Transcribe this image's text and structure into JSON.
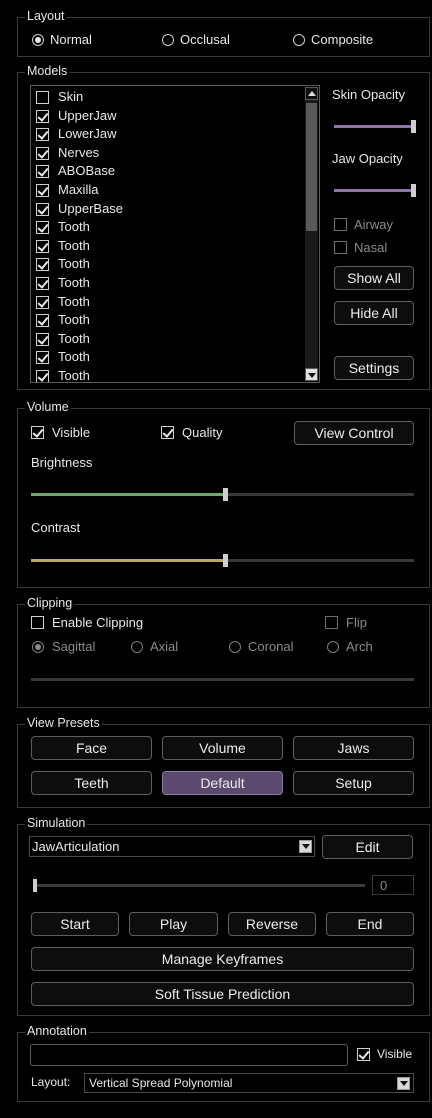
{
  "layout": {
    "title": "Layout",
    "options": [
      {
        "label": "Normal",
        "selected": true
      },
      {
        "label": "Occlusal",
        "selected": false
      },
      {
        "label": "Composite",
        "selected": false
      }
    ]
  },
  "models": {
    "title": "Models",
    "items": [
      {
        "label": "Skin",
        "checked": false
      },
      {
        "label": "UpperJaw",
        "checked": true
      },
      {
        "label": "LowerJaw",
        "checked": true
      },
      {
        "label": "Nerves",
        "checked": true
      },
      {
        "label": "ABOBase",
        "checked": true
      },
      {
        "label": "Maxilla",
        "checked": true
      },
      {
        "label": "UpperBase",
        "checked": true
      },
      {
        "label": "Tooth",
        "checked": true
      },
      {
        "label": "Tooth",
        "checked": true
      },
      {
        "label": "Tooth",
        "checked": true
      },
      {
        "label": "Tooth",
        "checked": true
      },
      {
        "label": "Tooth",
        "checked": true
      },
      {
        "label": "Tooth",
        "checked": true
      },
      {
        "label": "Tooth",
        "checked": true
      },
      {
        "label": "Tooth",
        "checked": true
      },
      {
        "label": "Tooth",
        "checked": true
      }
    ],
    "skin_opacity_label": "Skin Opacity",
    "skin_opacity_level": 1.0,
    "jaw_opacity_label": "Jaw Opacity",
    "jaw_opacity_level": 1.0,
    "airway_label": "Airway",
    "nasal_label": "Nasal",
    "show_all_label": "Show All",
    "hide_all_label": "Hide All",
    "settings_label": "Settings",
    "slider_color": "#8c74a8"
  },
  "volume": {
    "title": "Volume",
    "visible_label": "Visible",
    "quality_label": "Quality",
    "view_control_label": "View Control",
    "brightness_label": "Brightness",
    "brightness_level": 0.51,
    "brightness_color": "#6fa86a",
    "contrast_label": "Contrast",
    "contrast_level": 0.51,
    "contrast_color": "#b9a86b"
  },
  "clipping": {
    "title": "Clipping",
    "enable_label": "Enable Clipping",
    "flip_label": "Flip",
    "planes": [
      {
        "label": "Sagittal",
        "selected": true
      },
      {
        "label": "Axial",
        "selected": false
      },
      {
        "label": "Coronal",
        "selected": false
      },
      {
        "label": "Arch",
        "selected": false
      }
    ]
  },
  "presets": {
    "title": "View Presets",
    "buttons": [
      "Face",
      "Volume",
      "Jaws",
      "Teeth",
      "Default",
      "Setup"
    ],
    "active": "Default",
    "active_color": "#5b4a6e"
  },
  "simulation": {
    "title": "Simulation",
    "selected": "JawArticulation",
    "edit_label": "Edit",
    "frame_value": "0",
    "start_label": "Start",
    "play_label": "Play",
    "reverse_label": "Reverse",
    "end_label": "End",
    "keyframes_label": "Manage Keyframes",
    "soft_tissue_label": "Soft Tissue Prediction"
  },
  "annotation": {
    "title": "Annotation",
    "text_value": "",
    "visible_label": "Visible",
    "layout_label": "Layout:",
    "layout_value": "Vertical Spread Polynomial"
  }
}
